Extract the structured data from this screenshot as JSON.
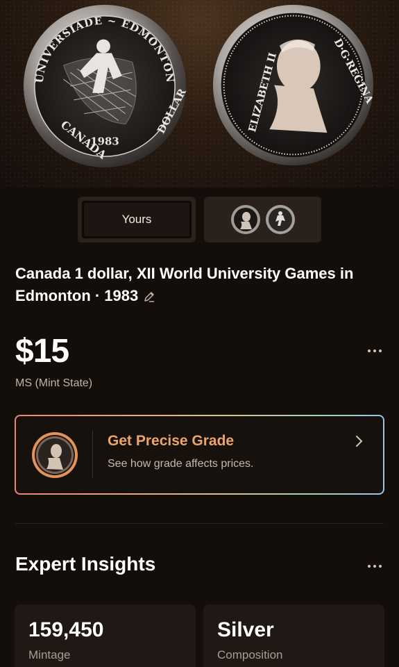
{
  "coin_images": {
    "reverse": {
      "legend_top": "UNIVERSIADE ~ EDMONTON",
      "legend_left": "CANADA",
      "legend_right": "DOLLAR",
      "year": "1983"
    },
    "obverse": {
      "legend_left": "ELIZABETH II",
      "legend_right": "D·G·REGINA"
    }
  },
  "tabs": {
    "yours_label": "Yours"
  },
  "coin": {
    "title": "Canada 1 dollar, XII World University Games in Edmonton · 1983"
  },
  "valuation": {
    "price": "$15",
    "grade": "MS (Mint State)"
  },
  "grade_card": {
    "title": "Get Precise Grade",
    "subtitle": "See how grade affects prices."
  },
  "insights": {
    "title": "Expert Insights",
    "stats": [
      {
        "value": "159,450",
        "label": "Mintage"
      },
      {
        "value": "Silver",
        "label": "Composition"
      }
    ]
  },
  "colors": {
    "accent": "#eba56b",
    "background": "#140e0b",
    "card": "#1f1814"
  }
}
